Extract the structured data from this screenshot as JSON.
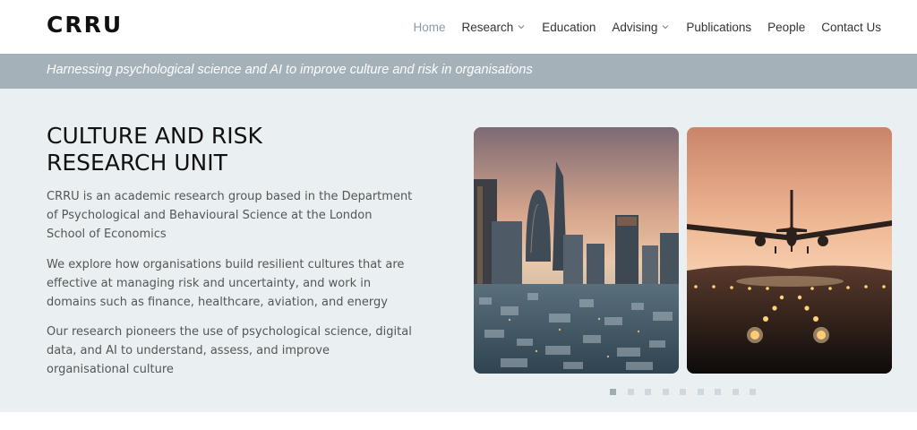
{
  "header": {
    "logo": "CRRU",
    "nav": [
      {
        "label": "Home",
        "active": true,
        "dropdown": false
      },
      {
        "label": "Research",
        "active": false,
        "dropdown": true
      },
      {
        "label": "Education",
        "active": false,
        "dropdown": false
      },
      {
        "label": "Advising",
        "active": false,
        "dropdown": true
      },
      {
        "label": "Publications",
        "active": false,
        "dropdown": false
      },
      {
        "label": "People",
        "active": false,
        "dropdown": false
      },
      {
        "label": "Contact Us",
        "active": false,
        "dropdown": false
      }
    ]
  },
  "tagline": "Harnessing psychological science and AI to improve culture and risk in organisations",
  "hero": {
    "title_line1": "CULTURE AND RISK",
    "title_line2": "RESEARCH UNIT",
    "paragraphs": [
      "CRRU is an academic research group based in the Department of Psychological and Behavioural Science at the London School of Economics",
      "We explore how organisations build resilient cultures that are effective at managing risk and uncertainty, and work in domains such as finance, healthcare, aviation, and energy",
      "Our research pioneers the use of psychological science, digital data, and AI to understand, assess, and improve organisational culture"
    ]
  },
  "gallery": {
    "images": [
      "london-city-skyline-image",
      "airplane-landing-runway-image"
    ],
    "slide_count": 9,
    "active_slide": 1
  },
  "colors": {
    "tagline_bar": "#a4b1b9",
    "hero_bg": "#eaf0f2",
    "nav_active": "#8a9aa6"
  }
}
